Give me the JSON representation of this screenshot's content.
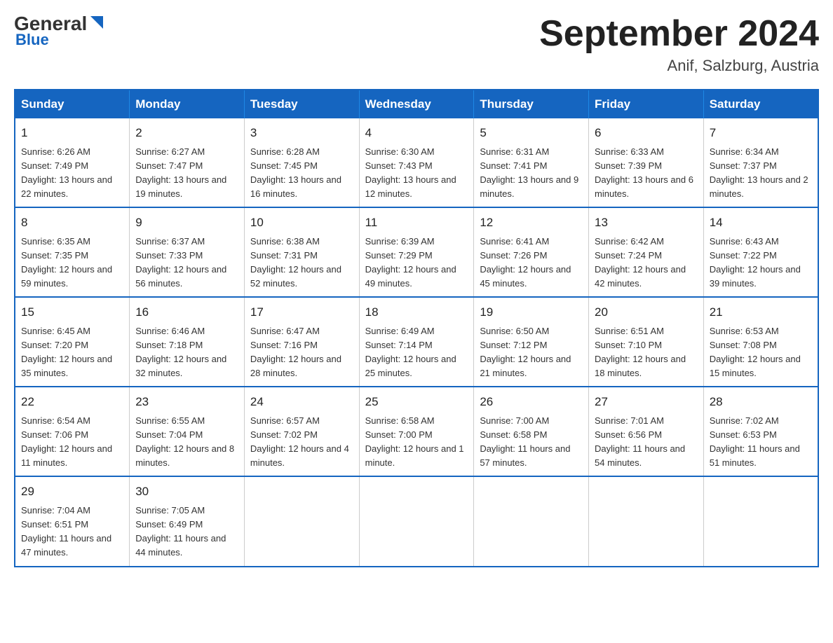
{
  "header": {
    "logo_general": "General",
    "logo_blue": "Blue",
    "month_title": "September 2024",
    "location": "Anif, Salzburg, Austria"
  },
  "weekdays": [
    "Sunday",
    "Monday",
    "Tuesday",
    "Wednesday",
    "Thursday",
    "Friday",
    "Saturday"
  ],
  "weeks": [
    [
      {
        "day": 1,
        "sunrise": "6:26 AM",
        "sunset": "7:49 PM",
        "daylight": "13 hours and 22 minutes"
      },
      {
        "day": 2,
        "sunrise": "6:27 AM",
        "sunset": "7:47 PM",
        "daylight": "13 hours and 19 minutes"
      },
      {
        "day": 3,
        "sunrise": "6:28 AM",
        "sunset": "7:45 PM",
        "daylight": "13 hours and 16 minutes"
      },
      {
        "day": 4,
        "sunrise": "6:30 AM",
        "sunset": "7:43 PM",
        "daylight": "13 hours and 12 minutes"
      },
      {
        "day": 5,
        "sunrise": "6:31 AM",
        "sunset": "7:41 PM",
        "daylight": "13 hours and 9 minutes"
      },
      {
        "day": 6,
        "sunrise": "6:33 AM",
        "sunset": "7:39 PM",
        "daylight": "13 hours and 6 minutes"
      },
      {
        "day": 7,
        "sunrise": "6:34 AM",
        "sunset": "7:37 PM",
        "daylight": "13 hours and 2 minutes"
      }
    ],
    [
      {
        "day": 8,
        "sunrise": "6:35 AM",
        "sunset": "7:35 PM",
        "daylight": "12 hours and 59 minutes"
      },
      {
        "day": 9,
        "sunrise": "6:37 AM",
        "sunset": "7:33 PM",
        "daylight": "12 hours and 56 minutes"
      },
      {
        "day": 10,
        "sunrise": "6:38 AM",
        "sunset": "7:31 PM",
        "daylight": "12 hours and 52 minutes"
      },
      {
        "day": 11,
        "sunrise": "6:39 AM",
        "sunset": "7:29 PM",
        "daylight": "12 hours and 49 minutes"
      },
      {
        "day": 12,
        "sunrise": "6:41 AM",
        "sunset": "7:26 PM",
        "daylight": "12 hours and 45 minutes"
      },
      {
        "day": 13,
        "sunrise": "6:42 AM",
        "sunset": "7:24 PM",
        "daylight": "12 hours and 42 minutes"
      },
      {
        "day": 14,
        "sunrise": "6:43 AM",
        "sunset": "7:22 PM",
        "daylight": "12 hours and 39 minutes"
      }
    ],
    [
      {
        "day": 15,
        "sunrise": "6:45 AM",
        "sunset": "7:20 PM",
        "daylight": "12 hours and 35 minutes"
      },
      {
        "day": 16,
        "sunrise": "6:46 AM",
        "sunset": "7:18 PM",
        "daylight": "12 hours and 32 minutes"
      },
      {
        "day": 17,
        "sunrise": "6:47 AM",
        "sunset": "7:16 PM",
        "daylight": "12 hours and 28 minutes"
      },
      {
        "day": 18,
        "sunrise": "6:49 AM",
        "sunset": "7:14 PM",
        "daylight": "12 hours and 25 minutes"
      },
      {
        "day": 19,
        "sunrise": "6:50 AM",
        "sunset": "7:12 PM",
        "daylight": "12 hours and 21 minutes"
      },
      {
        "day": 20,
        "sunrise": "6:51 AM",
        "sunset": "7:10 PM",
        "daylight": "12 hours and 18 minutes"
      },
      {
        "day": 21,
        "sunrise": "6:53 AM",
        "sunset": "7:08 PM",
        "daylight": "12 hours and 15 minutes"
      }
    ],
    [
      {
        "day": 22,
        "sunrise": "6:54 AM",
        "sunset": "7:06 PM",
        "daylight": "12 hours and 11 minutes"
      },
      {
        "day": 23,
        "sunrise": "6:55 AM",
        "sunset": "7:04 PM",
        "daylight": "12 hours and 8 minutes"
      },
      {
        "day": 24,
        "sunrise": "6:57 AM",
        "sunset": "7:02 PM",
        "daylight": "12 hours and 4 minutes"
      },
      {
        "day": 25,
        "sunrise": "6:58 AM",
        "sunset": "7:00 PM",
        "daylight": "12 hours and 1 minute"
      },
      {
        "day": 26,
        "sunrise": "7:00 AM",
        "sunset": "6:58 PM",
        "daylight": "11 hours and 57 minutes"
      },
      {
        "day": 27,
        "sunrise": "7:01 AM",
        "sunset": "6:56 PM",
        "daylight": "11 hours and 54 minutes"
      },
      {
        "day": 28,
        "sunrise": "7:02 AM",
        "sunset": "6:53 PM",
        "daylight": "11 hours and 51 minutes"
      }
    ],
    [
      {
        "day": 29,
        "sunrise": "7:04 AM",
        "sunset": "6:51 PM",
        "daylight": "11 hours and 47 minutes"
      },
      {
        "day": 30,
        "sunrise": "7:05 AM",
        "sunset": "6:49 PM",
        "daylight": "11 hours and 44 minutes"
      },
      null,
      null,
      null,
      null,
      null
    ]
  ]
}
